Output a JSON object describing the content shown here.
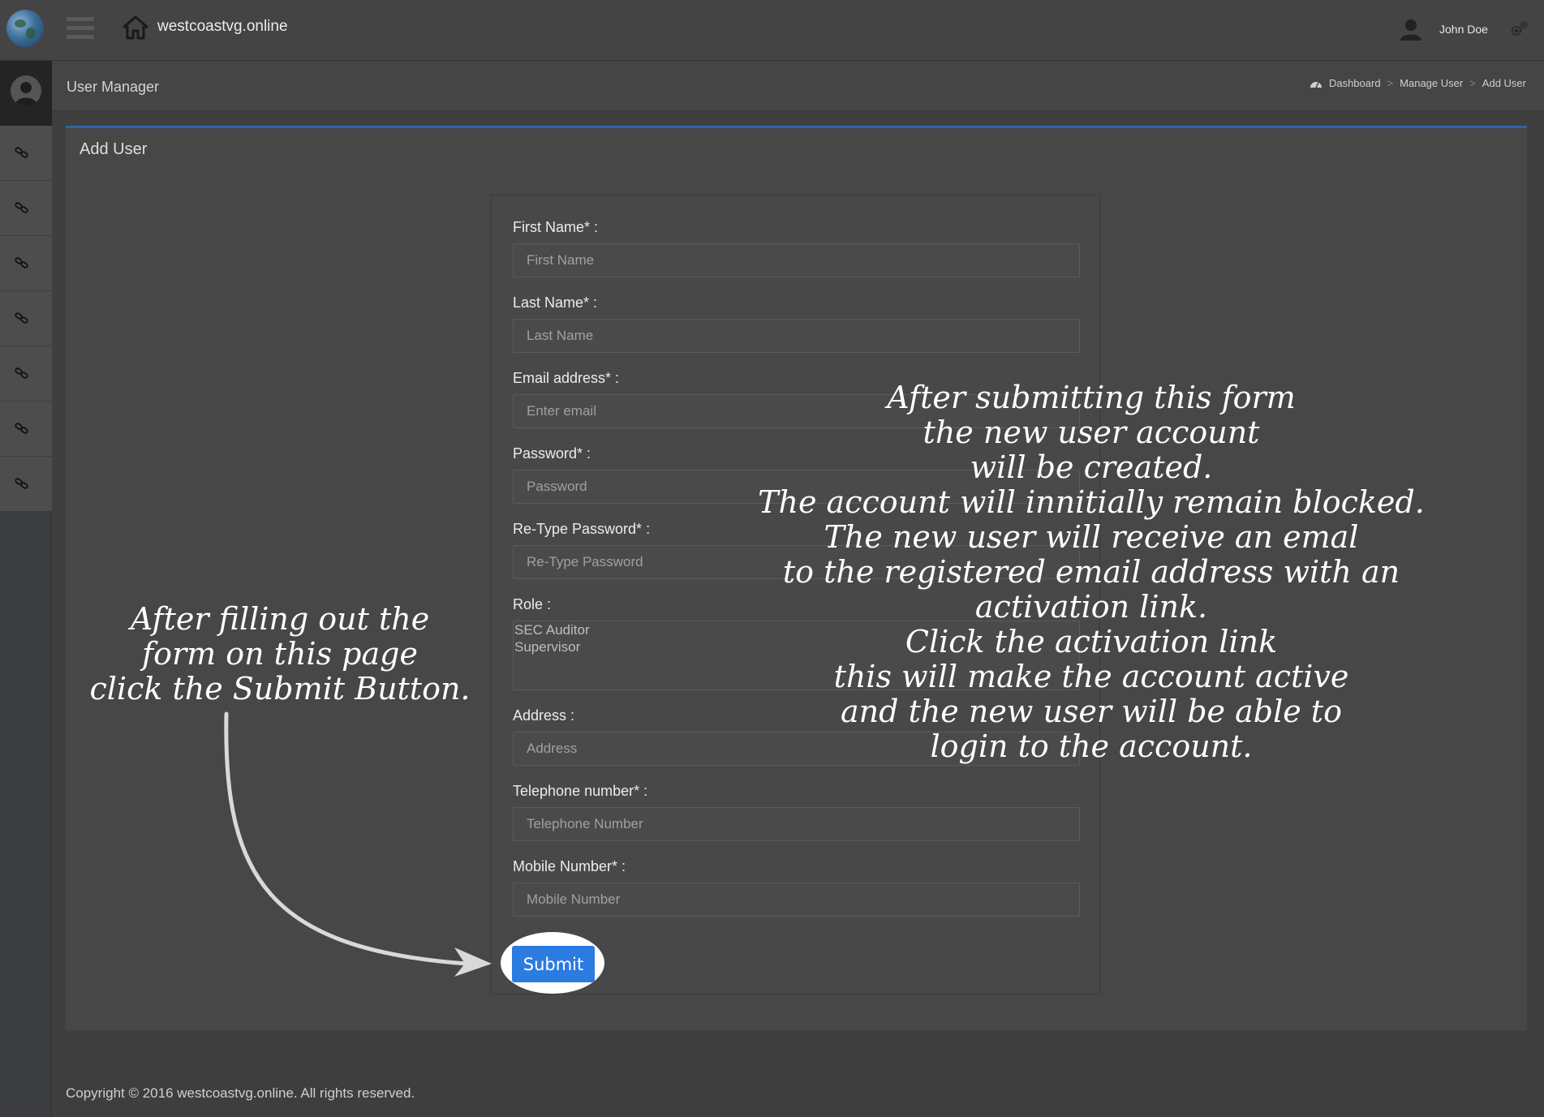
{
  "app": {
    "brand": "westcoastvg.online",
    "user_name": "John Doe"
  },
  "header": {
    "page_title": "User Manager",
    "breadcrumb": [
      "Dashboard",
      "Manage User",
      "Add User"
    ]
  },
  "panel": {
    "title": "Add User"
  },
  "form": {
    "first_name": {
      "label": "First Name* :",
      "placeholder": "First Name"
    },
    "last_name": {
      "label": "Last Name* :",
      "placeholder": "Last Name"
    },
    "email": {
      "label": "Email address* :",
      "placeholder": "Enter email"
    },
    "password": {
      "label": "Password* :",
      "placeholder": "Password"
    },
    "retype_password": {
      "label": "Re-Type Password* :",
      "placeholder": "Re-Type Password"
    },
    "role": {
      "label": "Role :",
      "options": [
        "SEC Auditor",
        "Supervisor"
      ]
    },
    "address": {
      "label": "Address :",
      "placeholder": "Address"
    },
    "telephone": {
      "label": "Telephone number* :",
      "placeholder": "Telephone Number"
    },
    "mobile": {
      "label": "Mobile Number* :",
      "placeholder": "Mobile Number"
    },
    "submit_label": "Submit"
  },
  "footer": {
    "copyright": "Copyright © 2016 westcoastvg.online. All rights reserved."
  },
  "annotations": {
    "left": [
      "After filling out the",
      "form on this page",
      "click the Submit Button."
    ],
    "right": [
      "After submitting this form",
      "the new user account",
      "will be created.",
      "The account will innitially remain blocked.",
      "The new user will receive an emal",
      "to the registered email address with an",
      "activation link.",
      "Click the activation link",
      "this will make the account active",
      "and the new user will be able to",
      "login to the account."
    ]
  },
  "sidebar": {
    "item_icon": "link-icon",
    "item_count": 7
  },
  "colors": {
    "accent": "#2c7be0",
    "panel_border": "#2a64a8"
  }
}
